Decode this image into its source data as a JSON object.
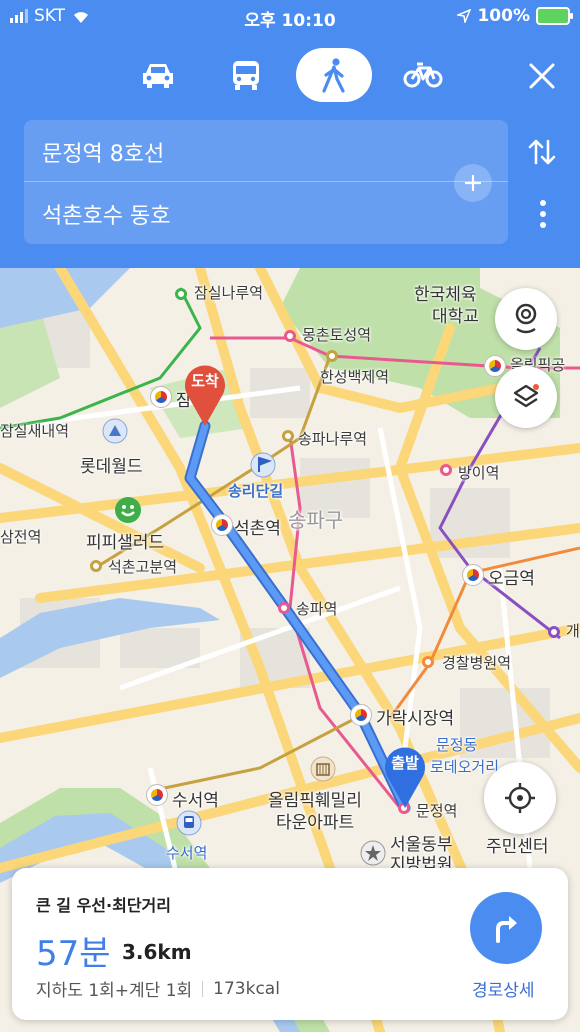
{
  "status_bar": {
    "carrier": "SKT",
    "time": "오후 10:10",
    "battery": "100%"
  },
  "modes": [
    {
      "name": "car",
      "icon": "car-icon"
    },
    {
      "name": "bus",
      "icon": "bus-icon"
    },
    {
      "name": "walk",
      "icon": "walk-icon",
      "active": true
    },
    {
      "name": "bike",
      "icon": "bike-icon"
    }
  ],
  "route": {
    "origin": "문정역 8호선",
    "destination": "석촌호수 동호"
  },
  "map": {
    "labels": {
      "jamsilnaru": "잠실나루역",
      "mongchon": "몽촌토성역",
      "hanseong": "한성백제역",
      "olympic": "올림픽공",
      "sports1": "한국체육",
      "sports2": "대학교",
      "jamsil": "잠실",
      "jamsilsae": "잠실새내역",
      "lotteworld": "롯데월드",
      "songpanaru": "송파나루역",
      "bangi": "방이역",
      "songridan": "송리단길",
      "songpagu": "송파구",
      "samjeon": "삼전역",
      "pipi": "피피샐러드",
      "seokchon": "석촌역",
      "seokchongobun": "석촌고분역",
      "ogeum": "오금역",
      "songpa": "송파역",
      "gae": "개",
      "police": "경찰병원역",
      "garak": "가락시장역",
      "munjeong1": "문정동",
      "munjeong2": "로데오거리",
      "suseo": "수서역",
      "suseo2": "수서역",
      "olympicfam1": "올림픽훼밀리",
      "olympicfam2": "타운아파트",
      "munjeongst": "문정역",
      "court1": "서울동부",
      "court2": "지방법원",
      "center": "주민센터"
    },
    "pins": {
      "arrival": "도착",
      "departure": "출발"
    }
  },
  "summary": {
    "type": "큰 길 우선·최단거리",
    "time": "57분",
    "distance": "3.6km",
    "transfers": "지하도 1회+계단 1회",
    "calories": "173kcal",
    "detail_label": "경로상세"
  },
  "colors": {
    "accent": "#4a8cf0",
    "route": "#4a8cf0",
    "arrival_pin": "#e0503c",
    "departure_pin": "#2f6fe0"
  }
}
